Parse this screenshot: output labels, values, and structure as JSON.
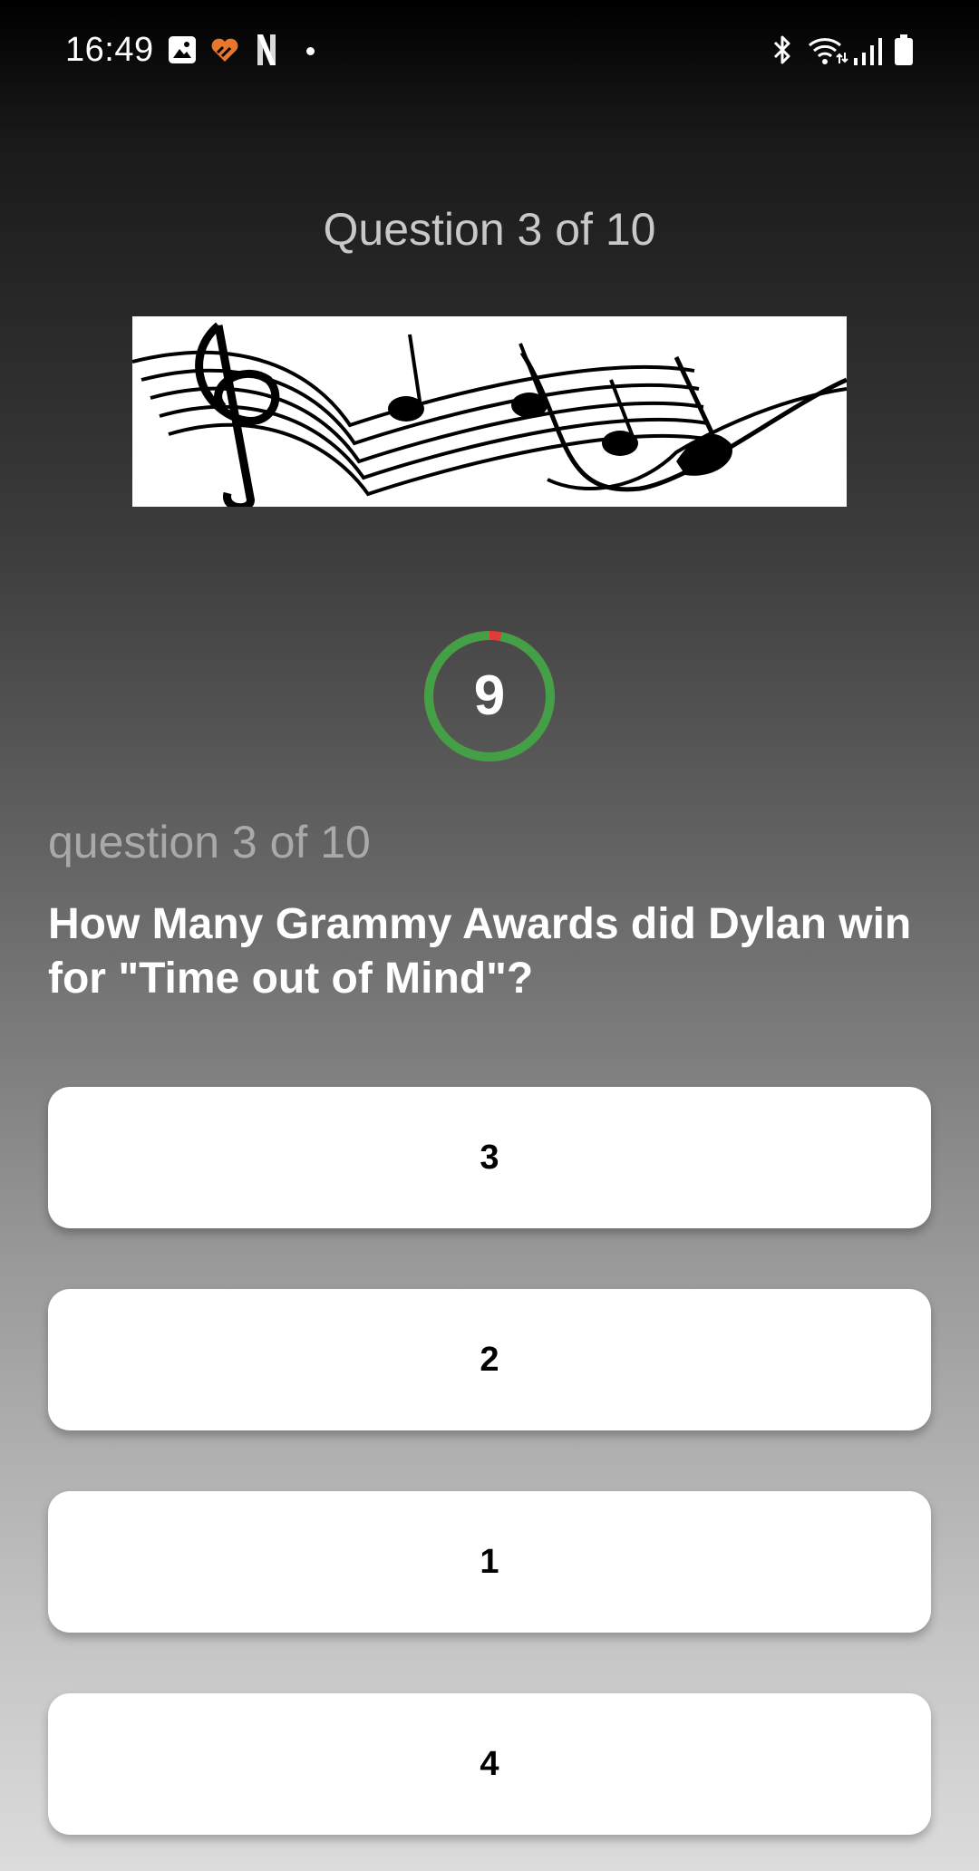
{
  "status_bar": {
    "time": "16:49",
    "icons": [
      "gallery-icon",
      "heart-icon",
      "netflix-icon",
      "notification-dot-icon",
      "bluetooth-icon",
      "wifi-icon",
      "signal-icon",
      "battery-icon"
    ]
  },
  "header": {
    "title": "Question 3 of 10"
  },
  "banner": {
    "image": "music-notes-icon"
  },
  "timer": {
    "value": "9",
    "ring_color": "#43a047",
    "elapsed_color": "#e53935",
    "remaining_fraction": 0.97
  },
  "question": {
    "counter": "question 3 of 10",
    "text": "How Many Grammy Awards did Dylan win for \"Time out of Mind\"?"
  },
  "answers": [
    {
      "label": "3"
    },
    {
      "label": "2"
    },
    {
      "label": "1"
    },
    {
      "label": "4"
    }
  ]
}
